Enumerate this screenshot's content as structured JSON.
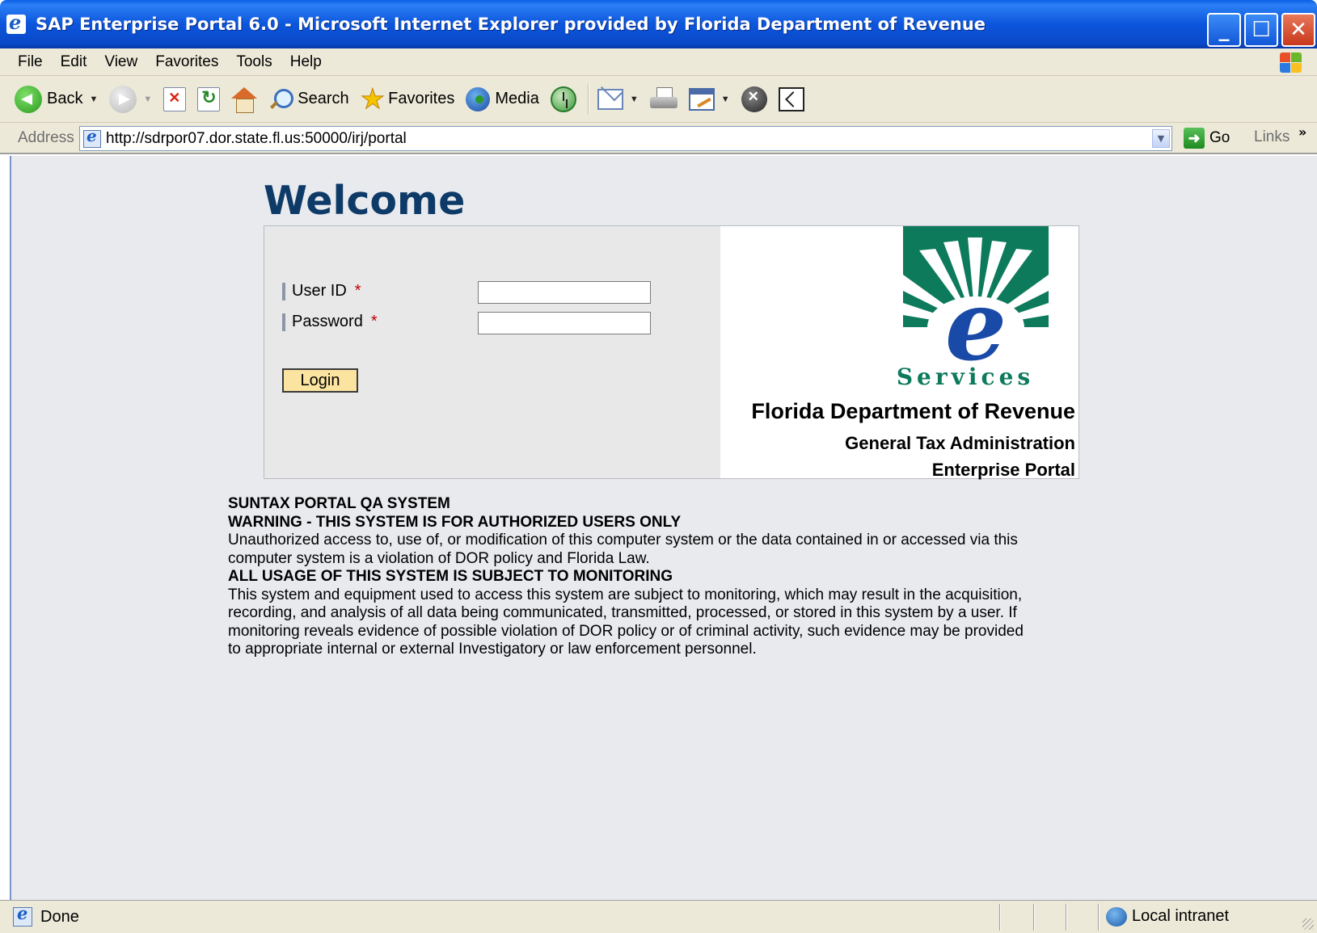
{
  "window": {
    "title": "SAP Enterprise Portal 6.0 - Microsoft Internet Explorer provided by Florida Department of Revenue"
  },
  "menu": {
    "items": [
      "File",
      "Edit",
      "View",
      "Favorites",
      "Tools",
      "Help"
    ]
  },
  "toolbar": {
    "back_label": "Back",
    "search_label": "Search",
    "favorites_label": "Favorites",
    "media_label": "Media"
  },
  "address": {
    "label": "Address",
    "url": "http://sdrpor07.dor.state.fl.us:50000/irj/portal",
    "go_label": "Go",
    "links_label": "Links",
    "more_glyph": "»"
  },
  "page": {
    "heading": "Welcome",
    "user_id_label": "User ID",
    "password_label": "Password",
    "required_marker": "*",
    "user_id_value": "",
    "password_value": "",
    "login_label": "Login",
    "logo_text": "Services",
    "org_name": "Florida Department of Revenue",
    "org_division": "General Tax Administration",
    "org_portal": "Enterprise Portal",
    "notice": {
      "system_name": "SUNTAX PORTAL QA SYSTEM",
      "warning": "WARNING - THIS SYSTEM IS FOR AUTHORIZED USERS ONLY",
      "para1_line1": "Unauthorized access to, use of, or modification of this computer system or the data contained in or accessed via this",
      "para1_line2": "computer system is a violation of DOR policy and Florida Law.",
      "monitoring": "ALL USAGE OF THIS SYSTEM IS SUBJECT TO MONITORING",
      "para2_line1": "This system and equipment used to access this system are subject to monitoring, which may result in the acquisition,",
      "para2_line2": "recording, and analysis of all data being communicated, transmitted, processed, or stored in this system by a user. If",
      "para2_line3": "monitoring reveals evidence of possible violation of DOR policy or of criminal activity, such evidence may be provided",
      "para2_line4": "to appropriate internal or external Investigatory or law enforcement personnel."
    }
  },
  "status": {
    "text": "Done",
    "zone": "Local intranet"
  },
  "colors": {
    "heading": "#0e3a68",
    "logo_green": "#0d7a5c",
    "logo_blue": "#1a4aa8",
    "login_button": "#fbe3a0",
    "required": "#c00000"
  }
}
